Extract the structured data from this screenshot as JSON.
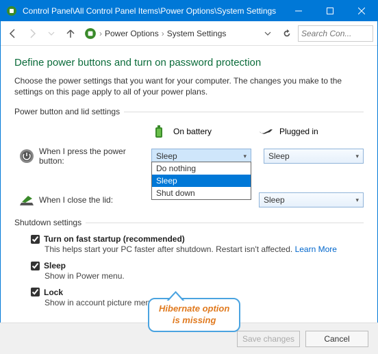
{
  "titlebar": {
    "path": "Control Panel\\All Control Panel Items\\Power Options\\System Settings"
  },
  "breadcrumb": {
    "item1": "Power Options",
    "item2": "System Settings"
  },
  "search": {
    "placeholder": "Search Con..."
  },
  "heading": "Define power buttons and turn on password protection",
  "description": "Choose the power settings that you want for your computer. The changes you make to the settings on this page apply to all of your power plans.",
  "section_power": "Power button and lid settings",
  "columns": {
    "battery": "On battery",
    "plugged": "Plugged in"
  },
  "rows": {
    "power_button": {
      "label": "When I press the power button:",
      "battery": "Sleep",
      "plugged": "Sleep"
    },
    "lid": {
      "label": "When I close the lid:",
      "plugged": "Sleep"
    }
  },
  "dropdown_options": {
    "opt1": "Do nothing",
    "opt2": "Sleep",
    "opt3": "Shut down"
  },
  "section_shutdown": "Shutdown settings",
  "shutdown": {
    "fast": {
      "title": "Turn on fast startup (recommended)",
      "sub": "This helps start your PC faster after shutdown. Restart isn't affected. ",
      "link": "Learn More"
    },
    "sleep": {
      "title": "Sleep",
      "sub": "Show in Power menu."
    },
    "lock": {
      "title": "Lock",
      "sub": "Show in account picture menu."
    }
  },
  "callout": {
    "line1": "Hibernate option",
    "line2": "is missing"
  },
  "footer": {
    "save": "Save changes",
    "cancel": "Cancel"
  }
}
